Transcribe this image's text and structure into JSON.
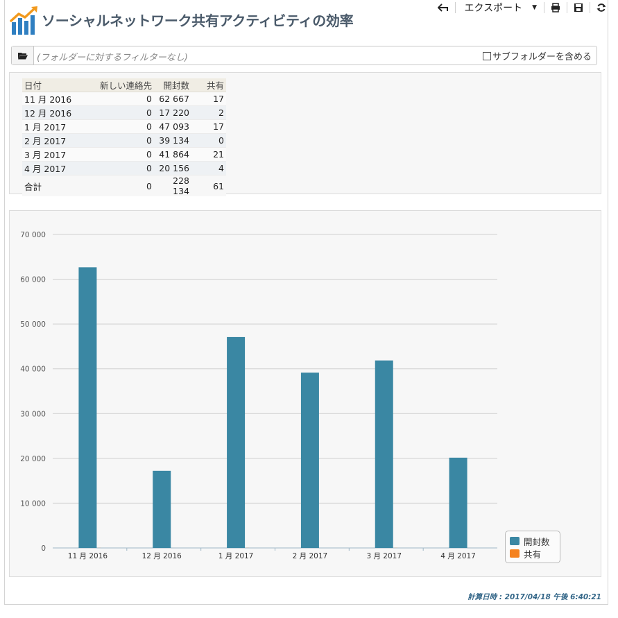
{
  "header": {
    "title": "ソーシャルネットワーク共有アクティビティの効率",
    "toolbar": {
      "back_icon": "back-arrow-icon",
      "export_label": "エクスポート",
      "print_icon": "printer-icon",
      "save_icon": "floppy-disk-icon",
      "refresh_icon": "refresh-icon"
    }
  },
  "filter": {
    "folder_icon": "folder-open-icon",
    "placeholder": "(フォルダーに対するフィルターなし)",
    "subfolder_label": "サブフォルダーを含める",
    "subfolder_checked": false
  },
  "table": {
    "columns": [
      "日付",
      "新しい連絡先",
      "開封数",
      "共有"
    ],
    "rows": [
      [
        "11 月 2016",
        "0",
        "62 667",
        "17"
      ],
      [
        "12 月 2016",
        "0",
        "17 220",
        "2"
      ],
      [
        "1 月 2017",
        "0",
        "47 093",
        "17"
      ],
      [
        "2 月 2017",
        "0",
        "39 134",
        "0"
      ],
      [
        "3 月 2017",
        "0",
        "41 864",
        "21"
      ],
      [
        "4 月 2017",
        "0",
        "20 156",
        "4"
      ]
    ],
    "total": [
      "合計",
      "0",
      "228 134",
      "61"
    ]
  },
  "chart_data": {
    "type": "bar",
    "categories": [
      "11 月 2016",
      "12 月 2016",
      "1 月 2017",
      "2 月 2017",
      "3 月 2017",
      "4 月 2017"
    ],
    "series": [
      {
        "name": "開封数",
        "color": "#3a87a3",
        "values": [
          62667,
          17220,
          47093,
          39134,
          41864,
          20156
        ]
      },
      {
        "name": "共有",
        "color": "#f5821f",
        "values": [
          17,
          2,
          17,
          0,
          21,
          4
        ]
      }
    ],
    "ylim": [
      0,
      70000
    ],
    "yticks": [
      0,
      10000,
      20000,
      30000,
      40000,
      50000,
      60000,
      70000
    ],
    "ytick_labels": [
      "0",
      "10 000",
      "20 000",
      "30 000",
      "40 000",
      "50 000",
      "60 000",
      "70 000"
    ],
    "grid": true,
    "legend_position": "bottom-right"
  },
  "footer": {
    "computed_at": "計算日時 : 2017/04/18 午後 6:40:21"
  },
  "colors": {
    "accent": "#3a87a3",
    "secondary": "#f5821f",
    "title": "#4a5a6a",
    "footer": "#336688"
  }
}
